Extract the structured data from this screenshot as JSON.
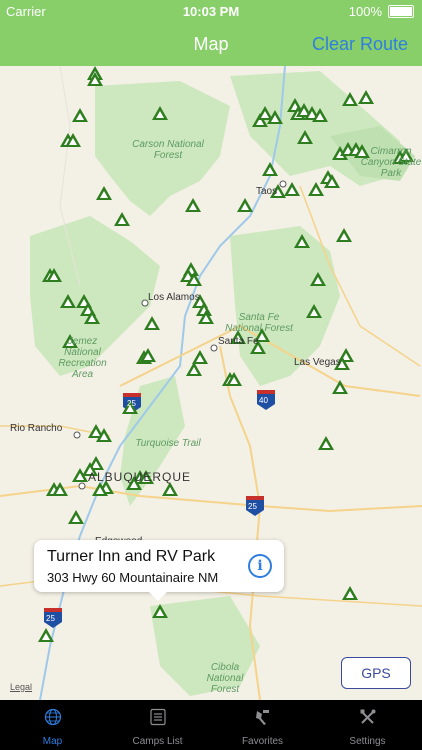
{
  "status_bar": {
    "carrier": "Carrier",
    "time": "10:03 PM",
    "battery": "100%"
  },
  "nav": {
    "title": "Map",
    "right_button": "Clear Route"
  },
  "map": {
    "region_labels": [
      "Carson National Forest",
      "Santa Fe National Forest",
      "Jemez National Recreation Area",
      "Cibola National Forest",
      "Cimarron Canyon State Park",
      "Turquoise Trail"
    ],
    "cities": [
      "Taos",
      "Los Alamos",
      "Santa Fe",
      "Las Vegas",
      "Rio Rancho",
      "ALBUQUERQUE",
      "Edgewood"
    ],
    "highways": [
      "25",
      "40",
      "25",
      "25"
    ],
    "legal": "Legal",
    "marker_icon": "campground-triangle-icon",
    "marker_color": "#2e7d1f"
  },
  "callout": {
    "title": "Turner Inn and RV Park",
    "subtitle": "303 Hwy 60 Mountainaire NM"
  },
  "gps_button": "GPS",
  "tabs": [
    {
      "label": "Map",
      "icon": "globe-icon",
      "active": true
    },
    {
      "label": "Camps List",
      "icon": "list-icon",
      "active": false
    },
    {
      "label": "Favorites",
      "icon": "favorites-icon",
      "active": false
    },
    {
      "label": "Settings",
      "icon": "tools-icon",
      "active": false
    }
  ]
}
